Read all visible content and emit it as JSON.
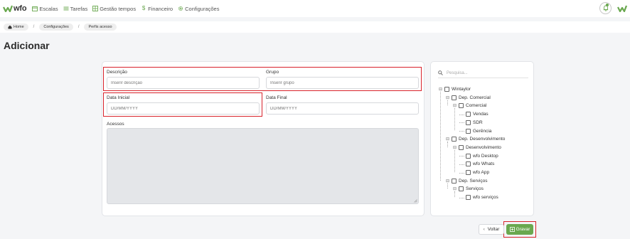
{
  "app": {
    "logo_text": "wfo",
    "brand_color": "#6aa84f",
    "highlight_color": "#d8222b"
  },
  "nav": {
    "items": [
      {
        "label": "Escalas",
        "icon": "calendar-icon"
      },
      {
        "label": "Tarefas",
        "icon": "list-icon"
      },
      {
        "label": "Gestão tempos",
        "icon": "table-icon"
      },
      {
        "label": "Financeiro",
        "icon": "dollar-icon"
      },
      {
        "label": "Configurações",
        "icon": "gear-icon"
      }
    ]
  },
  "breadcrumb": [
    "Home",
    "Configurações",
    "Perfis acesso"
  ],
  "page": {
    "title": "Adicionar"
  },
  "form": {
    "descricao": {
      "label": "Descrição",
      "placeholder": "Inserir descrição"
    },
    "grupo": {
      "label": "Grupo",
      "placeholder": "Inserir grupo"
    },
    "data_inicial": {
      "label": "Data Inicial",
      "placeholder": "DD/MM/YYYY"
    },
    "data_final": {
      "label": "Data Final",
      "placeholder": "DD/MM/YYYY"
    },
    "acessos": {
      "label": "Acessos"
    }
  },
  "tree": {
    "search_placeholder": "Pesquisa...",
    "nodes": [
      {
        "label": "Wintaylor",
        "level": 0,
        "expandable": true
      },
      {
        "label": "Dep. Comercial",
        "level": 1,
        "expandable": true
      },
      {
        "label": "Comercial",
        "level": 2,
        "expandable": true
      },
      {
        "label": "Vendas",
        "level": 3,
        "expandable": false
      },
      {
        "label": "SDR",
        "level": 3,
        "expandable": false
      },
      {
        "label": "Gerência",
        "level": 3,
        "expandable": false
      },
      {
        "label": "Dep. Desenvolvimento",
        "level": 1,
        "expandable": true
      },
      {
        "label": "Desenvolvimento",
        "level": 2,
        "expandable": true
      },
      {
        "label": "wfo Desktop",
        "level": 3,
        "expandable": false
      },
      {
        "label": "wfo Whats",
        "level": 3,
        "expandable": false
      },
      {
        "label": "wfo App",
        "level": 3,
        "expandable": false
      },
      {
        "label": "Dep. Serviços",
        "level": 1,
        "expandable": true
      },
      {
        "label": "Serviços",
        "level": 2,
        "expandable": true
      },
      {
        "label": "wfo serviços",
        "level": 3,
        "expandable": false
      }
    ]
  },
  "actions": {
    "voltar": "Voltar",
    "gravar": "Gravar"
  }
}
